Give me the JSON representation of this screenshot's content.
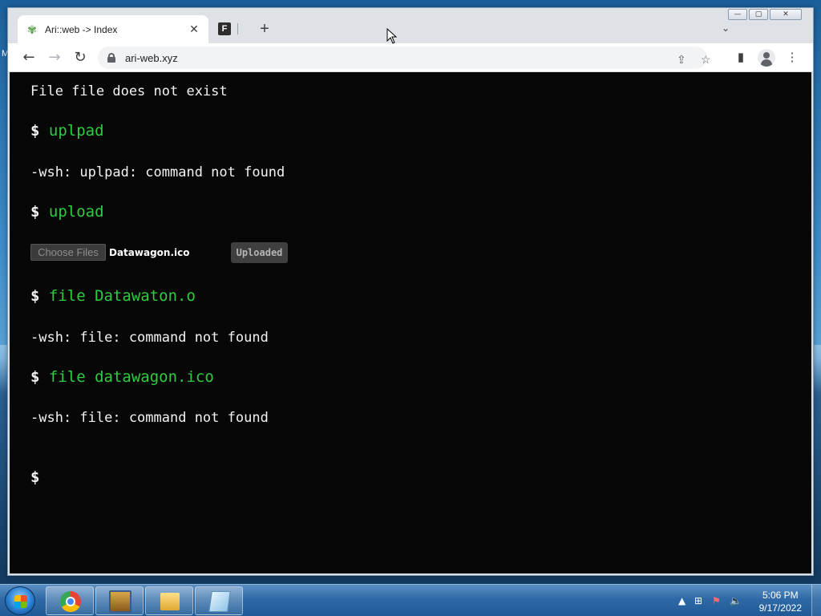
{
  "desktop": {
    "edge_text": "M"
  },
  "window": {
    "controls": {
      "minimize": "—",
      "maximize": "▢",
      "close": "✕"
    }
  },
  "browser": {
    "tabs": [
      {
        "title": "Ari::web -> Index",
        "favicon": "ari-leaf-icon",
        "active": true
      },
      {
        "title": "",
        "favicon": "doc-icon",
        "active": false
      }
    ],
    "new_tab_label": "+",
    "tab_search_label": "⌄",
    "url": "ari-web.xyz"
  },
  "terminal": {
    "colors": {
      "background": "#070707",
      "command": "#2ecc40",
      "output": "#f2f2f2"
    },
    "lines": [
      {
        "type": "output",
        "text": "File file does not exist"
      },
      {
        "type": "command",
        "prompt": "$",
        "text": "uplpad"
      },
      {
        "type": "output",
        "text": "-wsh: uplpad: command not found"
      },
      {
        "type": "command",
        "prompt": "$",
        "text": "upload"
      },
      {
        "type": "command",
        "prompt": "$",
        "text": "file Datawaton.o"
      },
      {
        "type": "output",
        "text": "-wsh: file: command not found"
      },
      {
        "type": "command",
        "prompt": "$",
        "text": "file datawagon.ico"
      },
      {
        "type": "output",
        "text": "-wsh: file: command not found"
      },
      {
        "type": "command",
        "prompt": "$",
        "text": ""
      }
    ],
    "upload": {
      "choose_label": "Choose Files",
      "file_name": "Datawagon.ico",
      "status_label": "Uploaded"
    }
  },
  "taskbar": {
    "apps": [
      "chrome-icon",
      "archive-icon",
      "folder-icon",
      "notepad-icon"
    ],
    "tray": {
      "up_arrow": "▲"
    },
    "clock": {
      "time": "5:06 PM",
      "date": "9/17/2022"
    }
  }
}
